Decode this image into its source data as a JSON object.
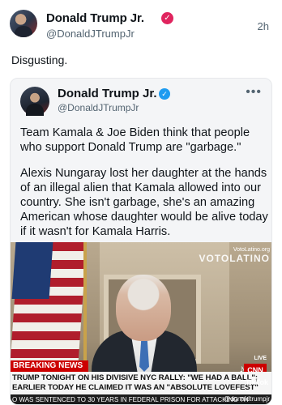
{
  "post": {
    "author_name": "Donald Trump Jr.",
    "author_handle": "@DonaldJTrumpJr",
    "time": "2h",
    "text": "Disgusting.",
    "verified_glyph": "✓",
    "badge_color": "#e0245e"
  },
  "embedded": {
    "author_name": "Donald Trump Jr.",
    "author_handle": "@DonaldJTrumpJr",
    "verified_glyph": "✓",
    "more_glyph": "•••",
    "paragraph1": "Team Kamala & Joe Biden think that people who support Donald Trump are \"garbage.\"",
    "paragraph2": "Alexis Nungaray lost her daughter at the hands of an illegal alien that Kamala allowed into our country. She isn't garbage, she's an amazing American whose daughter would be alive today if it wasn't for Kamala Harris."
  },
  "video": {
    "watermark_small": "VotoLatino.org",
    "watermark_big": "VOTOLATINO",
    "breaking_label": "BREAKING NEWS",
    "live_label": "LIVE",
    "network_logo": "CNN",
    "chyron_line1": "TRUMP TONIGHT ON HIS DIVISIVE NYC RALLY: \"WE HAD A BALL\";",
    "chyron_line2": "EARLIER TODAY HE CLAIMED IT WAS AN \"ABSOLUTE LOVEFEST\"",
    "ticker_text": "O WAS SENTENCED TO 30 YEARS IN FEDERAL PRISON FOR ATTACKING TH",
    "tiktok_label": "TikTok",
    "tiktok_handle": "@donaldtrumpjr",
    "tiktok_icon": "♪"
  }
}
